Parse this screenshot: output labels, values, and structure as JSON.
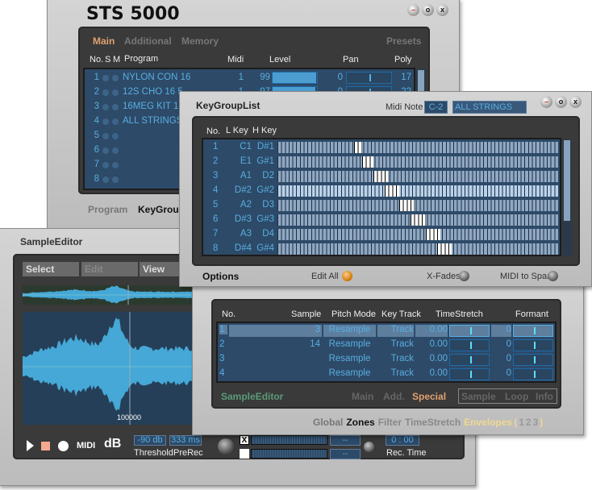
{
  "main_window": {
    "title": "STS 5000",
    "tabs": [
      "Main",
      "Additional",
      "Memory"
    ],
    "presets": "Presets",
    "columns": {
      "no": "No.",
      "s": "S",
      "m": "M",
      "program": "Program",
      "midi": "Midi",
      "level": "Level",
      "pan": "Pan",
      "poly": "Poly"
    },
    "programs": [
      {
        "no": "1",
        "name": "NYLON CON 16",
        "midi": "1",
        "level": "99",
        "level_pct": 99,
        "pan": "0",
        "poly": "17"
      },
      {
        "no": "2",
        "name": "12S CHO 16 5",
        "midi": "1",
        "level": "97",
        "level_pct": 97,
        "pan": "0",
        "poly": "22"
      },
      {
        "no": "3",
        "name": "16MEG KIT 1"
      },
      {
        "no": "4",
        "name": "ALL  STRINGS"
      },
      {
        "no": "5",
        "name": ""
      },
      {
        "no": "6",
        "name": ""
      },
      {
        "no": "7",
        "name": ""
      },
      {
        "no": "8",
        "name": ""
      }
    ],
    "bottom_tabs": [
      "Program",
      "KeyGroup"
    ]
  },
  "keygroup_window": {
    "title": "KeyGroupList",
    "midi_note_label": "Midi Note",
    "midi_note": "C-2",
    "program": "ALL  STRINGS",
    "columns": {
      "no": "No.",
      "lkey": "L Key",
      "hkey": "H Key"
    },
    "rows": [
      {
        "no": "1",
        "l": "C1",
        "h": "D#1"
      },
      {
        "no": "2",
        "l": "E1",
        "h": "G#1"
      },
      {
        "no": "3",
        "l": "A1",
        "h": "D2"
      },
      {
        "no": "4",
        "l": "D#2",
        "h": "G#2"
      },
      {
        "no": "5",
        "l": "A2",
        "h": "D3"
      },
      {
        "no": "6",
        "l": "D#3",
        "h": "G#3"
      },
      {
        "no": "7",
        "l": "A3",
        "h": "D4"
      },
      {
        "no": "8",
        "l": "D#4",
        "h": "G#4"
      }
    ],
    "selected_row": 4,
    "options": "Options",
    "edit_all": "Edit All",
    "x_fades": "X-Fades",
    "midi_to_span": "MIDI to Span"
  },
  "zones_window": {
    "columns": {
      "no": "No.",
      "sample": "Sample",
      "pitch": "Pitch Mode",
      "key": "Key Track",
      "ts": "TimeStretch",
      "formant": "Formant"
    },
    "rows": [
      {
        "no": "1",
        "sample": "3",
        "pitch": "Resample",
        "key": "Track",
        "ts": "0.00",
        "formant": "0"
      },
      {
        "no": "2",
        "sample": "14",
        "pitch": "Resample",
        "key": "Track",
        "ts": "0.00",
        "formant": "0"
      },
      {
        "no": "3",
        "sample": "",
        "pitch": "Resample",
        "key": "Track",
        "ts": "0.00",
        "formant": "0"
      },
      {
        "no": "4",
        "sample": "",
        "pitch": "Resample",
        "key": "Track",
        "ts": "0.00",
        "formant": "0"
      }
    ],
    "sample_editor": "SampleEditor",
    "tabs": [
      "Main",
      "Add.",
      "Special"
    ],
    "box_tabs": [
      "Sample",
      "Loop",
      "Info"
    ],
    "bottom_tabs": [
      "Global",
      "Zones",
      "Filter",
      "TimeStretch",
      "Envelopes",
      "(",
      "1",
      "2",
      "3",
      ")"
    ]
  },
  "sample_editor": {
    "title": "SampleEditor",
    "menu": [
      "Select",
      "Edit",
      "View"
    ],
    "marker": "100000",
    "midi": "MIDI",
    "db": "dB",
    "threshold": "-90 db",
    "threshold_label": "Threshold",
    "prerec": "333 ms",
    "prerec_label": "PreRec",
    "check1": "X",
    "level1": "--",
    "level2": "--",
    "rec_time": "0 : 00",
    "rec_time_label": "Rec. Time"
  },
  "colors": {
    "accent_orange": "#e0a070",
    "text_blue": "#59aee0",
    "list_bg": "#2d4a68",
    "envelopes": "#f0d890",
    "sample_editor_green": "#5a9a78"
  }
}
